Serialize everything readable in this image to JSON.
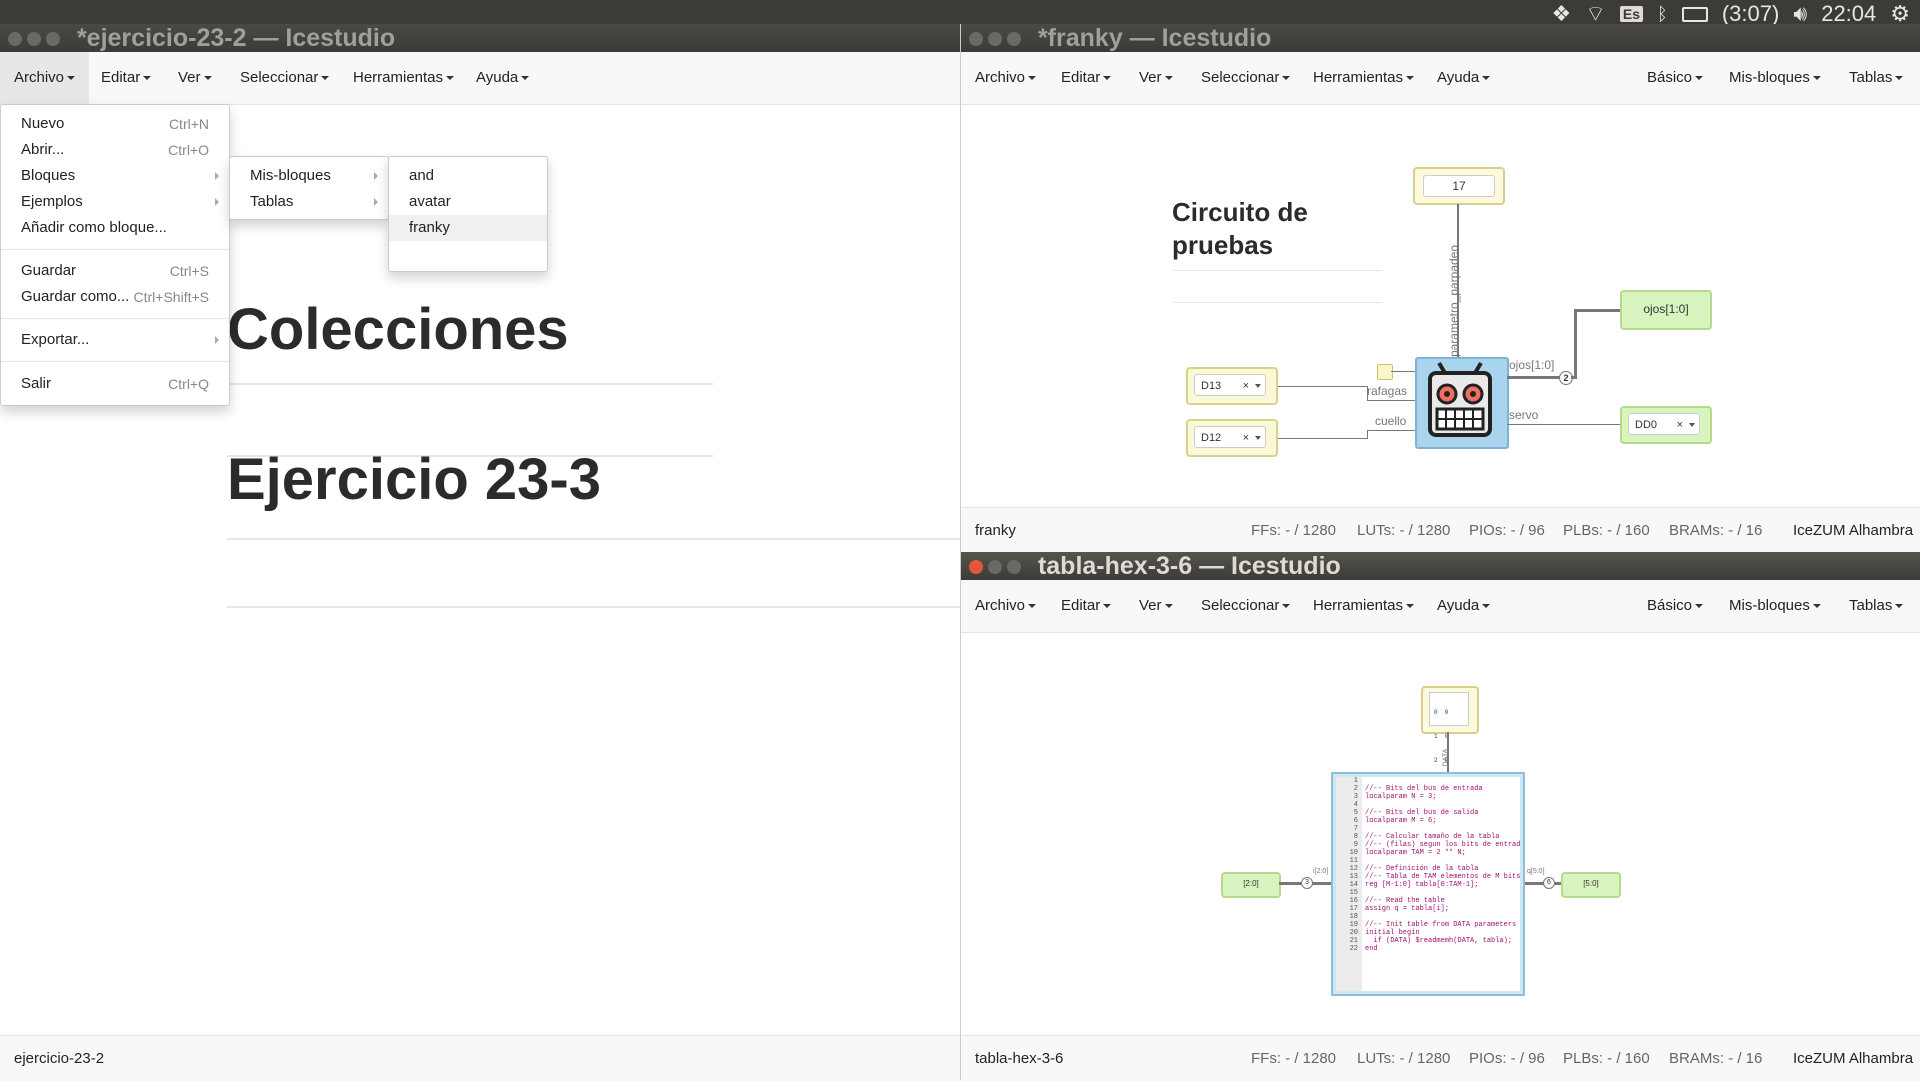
{
  "top_panel": {
    "keyboard": "Es",
    "battery": "(3:07)",
    "clock": "22:04"
  },
  "left_window": {
    "title": "*ejercicio-23-2 — Icestudio",
    "menu": [
      "Archivo",
      "Editar",
      "Ver",
      "Seleccionar",
      "Herramientas",
      "Ayuda"
    ],
    "archivo_menu": {
      "nuevo": "Nuevo",
      "nuevo_sc": "Ctrl+N",
      "abrir": "Abrir...",
      "abrir_sc": "Ctrl+O",
      "bloques": "Bloques",
      "ejemplos": "Ejemplos",
      "anadir": "Añadir como bloque...",
      "guardar": "Guardar",
      "guardar_sc": "Ctrl+S",
      "guardar_como": "Guardar como...",
      "guardar_como_sc": "Ctrl+Shift+S",
      "exportar": "Exportar...",
      "salir": "Salir",
      "salir_sc": "Ctrl+Q"
    },
    "bloques_submenu": [
      "Mis-bloques",
      "Tablas"
    ],
    "misbloques_submenu": [
      "and",
      "avatar",
      "franky"
    ],
    "canvas_texts": [
      "Colecciones",
      "Ejercicio 23-3"
    ],
    "status_name": "ejercicio-23-2"
  },
  "franky_window": {
    "title": "*franky — Icestudio",
    "menu": [
      "Archivo",
      "Editar",
      "Ver",
      "Seleccionar",
      "Herramientas",
      "Ayuda"
    ],
    "menu_right": [
      "Básico",
      "Mis-bloques",
      "Tablas"
    ],
    "comment_title": "Circuito de pruebas",
    "param_value": "17",
    "param_label": "parametro_parpadeo",
    "input1": "D13",
    "input2": "D12",
    "port_rafagas": "rafagas",
    "port_cuello": "cuello",
    "port_ojos": "ojos[1:0]",
    "port_servo": "servo",
    "bus_width": "2",
    "output_ojos": "ojos[1:0]",
    "output_dd0": "DD0",
    "status": {
      "name": "franky",
      "ffs": "FFs: - / 1280",
      "luts": "LUTs: - / 1280",
      "pios": "PIOs: - / 96",
      "plbs": "PLBs: - / 160",
      "brams": "BRAMs: - / 16",
      "board": "IceZUM Alhambra"
    }
  },
  "tabla_window": {
    "title": "tabla-hex-3-6 — Icestudio",
    "menu": [
      "Archivo",
      "Editar",
      "Ver",
      "Seleccionar",
      "Herramientas",
      "Ayuda"
    ],
    "menu_right": [
      "Básico",
      "Mis-bloques",
      "Tablas"
    ],
    "memory_rows": [
      "0  0",
      "1  0",
      "2  0",
      "3  0"
    ],
    "data_label": "DATA",
    "input_label": "[2:0]",
    "input_port": "i[2:0]",
    "input_width": "3",
    "output_label": "[5:0]",
    "output_port": "q[5:0]",
    "output_width": "6",
    "code_numbers": "1\n2\n3\n4\n5\n6\n7\n8\n9\n10\n11\n12\n13\n14\n15\n16\n17\n18\n19\n20\n21\n22",
    "code_text": "\n//-- Bits del bus de entrada\nlocalparam N = 3;\n\n//-- Bits del bus de salida\nlocalparam M = 6;\n\n//-- Calcular tamaño de la tabla\n//-- (filas) segun los bits de entrada\nlocalparam TAM = 2 ** N;\n\n//-- Definición de la tabla\n//-- Tabla de TAM elementos de M bits\nreg [M-1:0] tabla[0:TAM-1];\n\n//-- Read the table\nassign q = tabla[i];\n\n//-- Init table from DATA parameters\ninitial begin\n  if (DATA) $readmemh(DATA, tabla);\nend",
    "status": {
      "name": "tabla-hex-3-6",
      "ffs": "FFs: - / 1280",
      "luts": "LUTs: - / 1280",
      "pios": "PIOs: - / 96",
      "plbs": "PLBs: - / 160",
      "brams": "BRAMs: - / 16",
      "board": "IceZUM Alhambra"
    }
  },
  "colors": {
    "panel": "#3c3b37",
    "input_block": "#fbf8d6",
    "output_block": "#d8f5bf",
    "robot": "#a8d4ee"
  }
}
